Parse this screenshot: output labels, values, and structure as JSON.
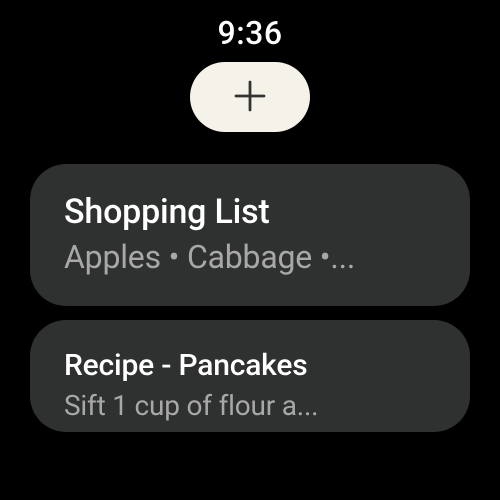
{
  "status": {
    "time": "9:36"
  },
  "actions": {
    "add_icon_name": "plus-icon"
  },
  "notes": [
    {
      "title": "Shopping List",
      "preview": "Apples • Cabbage •..."
    },
    {
      "title": "Recipe - Pancakes",
      "preview": "Sift 1 cup of flour a..."
    }
  ]
}
